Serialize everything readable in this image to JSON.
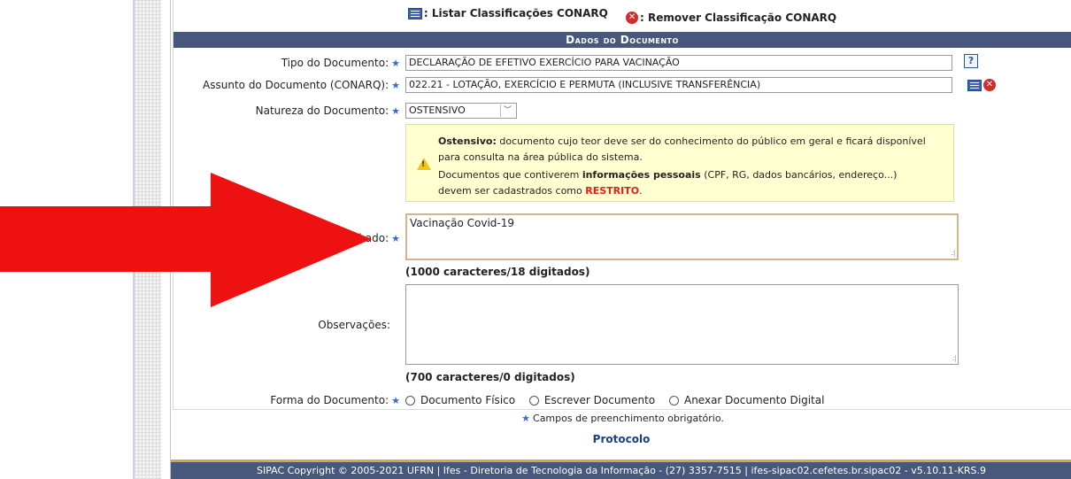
{
  "toolbar": {
    "list_label": ": Listar Classificações CONARQ",
    "remove_label": ": Remover Classificação CONARQ"
  },
  "section": {
    "title": "Dados do Documento"
  },
  "fields": {
    "tipo": {
      "label": "Tipo do Documento:",
      "value": "DECLARAÇÃO DE EFETIVO EXERCÍCIO PARA VACINAÇÃO"
    },
    "assunto": {
      "label": "Assunto do Documento (CONARQ):",
      "value": "022.21 - LOTAÇÃO, EXERCÍCIO E PERMUTA (INCLUSIVE TRANSFERÊNCIA)"
    },
    "natureza": {
      "label": "Natureza do Documento:",
      "value": "OSTENSIVO"
    },
    "assunto_detalhado": {
      "label": "Assunto Detalhado:",
      "value": "Vacinação Covid-19",
      "counter": "(1000 caracteres/18 digitados)"
    },
    "observacoes": {
      "label": "Observações:",
      "value": "",
      "counter": "(700 caracteres/0 digitados)"
    },
    "forma": {
      "label": "Forma do Documento:",
      "options": [
        "Documento Físico",
        "Escrever Documento",
        "Anexar Documento Digital"
      ]
    }
  },
  "warning": {
    "l1_bold": "Ostensivo:",
    "l1_text": " documento cujo teor deve ser do conhecimento do público em geral e ficará disponível",
    "l2": "para consulta na área pública do sistema.",
    "l3_pre": "Documentos que contiverem ",
    "l3_bold": "informações pessoais",
    "l3_post": " (CPF, RG, dados bancários, endereço...)",
    "l4_pre": "devem ser cadastrados como ",
    "l4_red": "RESTRITO",
    "l4_post": "."
  },
  "required_note": "Campos de preenchimento obrigatório.",
  "required_symbol": "★",
  "protocol_link": "Protocolo",
  "footer": "SIPAC Copyright © 2005-2021 UFRN | Ifes - Diretoria de Tecnologia da Informação - (27) 3357-7515 | ifes-sipac02.cefetes.br.sipac02 - v5.10.11-KRS.9",
  "icons": {
    "help": "?",
    "remove": "✕",
    "warning": "!"
  },
  "colors": {
    "header_bg": "#48587c",
    "arrow": "#ee1111",
    "required": "#3a6ad9",
    "restricted": "#e0201e"
  }
}
